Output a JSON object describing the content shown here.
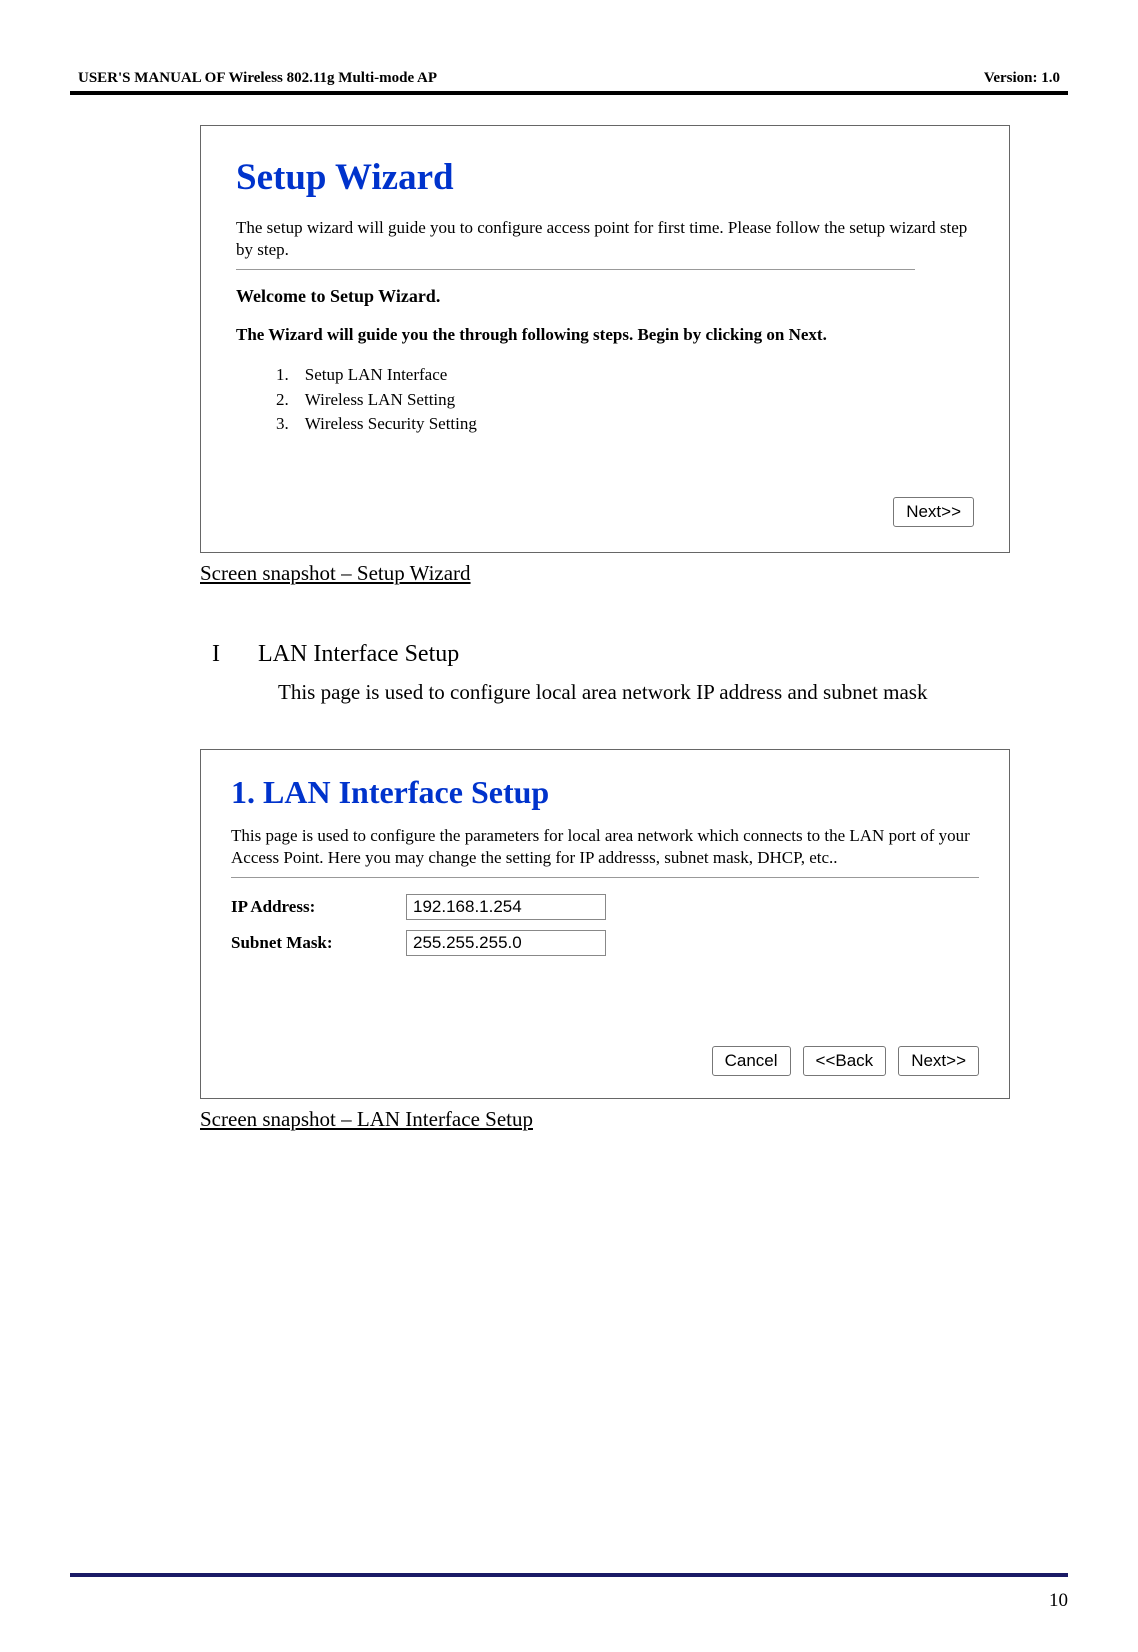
{
  "header": {
    "left": "USER'S MANUAL OF Wireless 802.11g Multi-mode AP",
    "right": "Version: 1.0"
  },
  "wizard": {
    "title": "Setup Wizard",
    "desc": "The setup wizard will guide you to configure access point for first time. Please follow the setup wizard step by step.",
    "welcome": "Welcome to Setup Wizard.",
    "guide": "The Wizard will guide you the through following steps. Begin by clicking on Next.",
    "steps": [
      {
        "num": "1.",
        "label": "Setup LAN Interface"
      },
      {
        "num": "2.",
        "label": "Wireless LAN Setting"
      },
      {
        "num": "3.",
        "label": "Wireless Security Setting"
      }
    ],
    "next": "Next>>"
  },
  "caption1": "Screen snapshot – Setup Wizard",
  "section": {
    "num": "I",
    "title": "LAN Interface Setup",
    "body": "This page is used to configure local area network IP address and subnet mask"
  },
  "lan": {
    "title": "1. LAN Interface Setup",
    "desc": "This page is used to configure the parameters for local area network which connects to the LAN port of your Access Point. Here you may change the setting for IP addresss, subnet mask, DHCP, etc..",
    "ip_label": "IP Address:",
    "ip_value": "192.168.1.254",
    "mask_label": "Subnet Mask:",
    "mask_value": "255.255.255.0",
    "cancel": "Cancel",
    "back": "<<Back",
    "next": "Next>>"
  },
  "caption2": "Screen snapshot – LAN Interface Setup",
  "page_number": "10"
}
